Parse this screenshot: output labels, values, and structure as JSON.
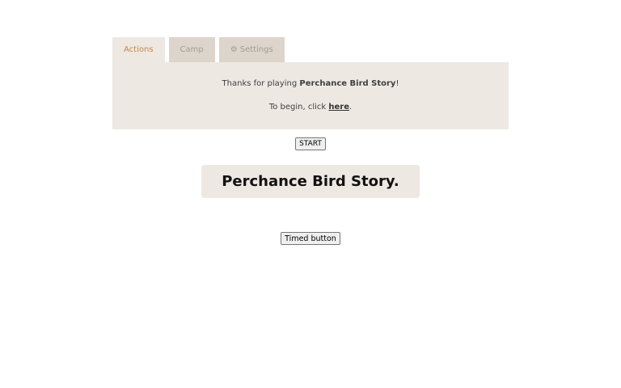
{
  "tabs": [
    {
      "label": "Actions",
      "active": true
    },
    {
      "label": "Camp",
      "active": false
    },
    {
      "label": "Settings",
      "active": false,
      "icon": "gear-icon"
    }
  ],
  "panel": {
    "intro_prefix": "Thanks for playing ",
    "game_name": "Perchance Bird Story",
    "intro_suffix": "!",
    "begin_prefix": "To begin, click ",
    "begin_link": "here",
    "begin_suffix": "."
  },
  "start_button": "START",
  "title": "Perchance Bird Story.",
  "timed_button": "Timed button",
  "colors": {
    "panel_bg": "#ede8e2",
    "tab_inactive_bg": "#ddd5cc",
    "tab_active_text": "#c08a4e"
  }
}
